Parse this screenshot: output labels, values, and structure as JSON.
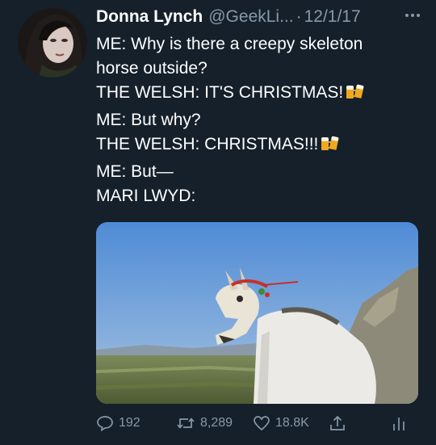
{
  "tweet": {
    "author_name": "Donna Lynch",
    "handle": "@GeekLi...",
    "separator": "·",
    "date": "12/1/17",
    "more_icon": "more-horizontal-icon",
    "lines": [
      "ME: Why is there a creepy skeleton",
      "horse outside?",
      "THE WELSH: IT'S CHRISTMAS!",
      "ME: But why?",
      "THE WELSH: CHRISTMAS!!!",
      "ME: But—",
      "MARI LWYD:"
    ],
    "emoji": "beer-mugs-emoji"
  },
  "actions": {
    "replies": "192",
    "retweets": "8,289",
    "likes": "18.8K"
  },
  "colors": {
    "background": "#15202b",
    "text": "#ffffff",
    "muted": "#8899a6"
  }
}
